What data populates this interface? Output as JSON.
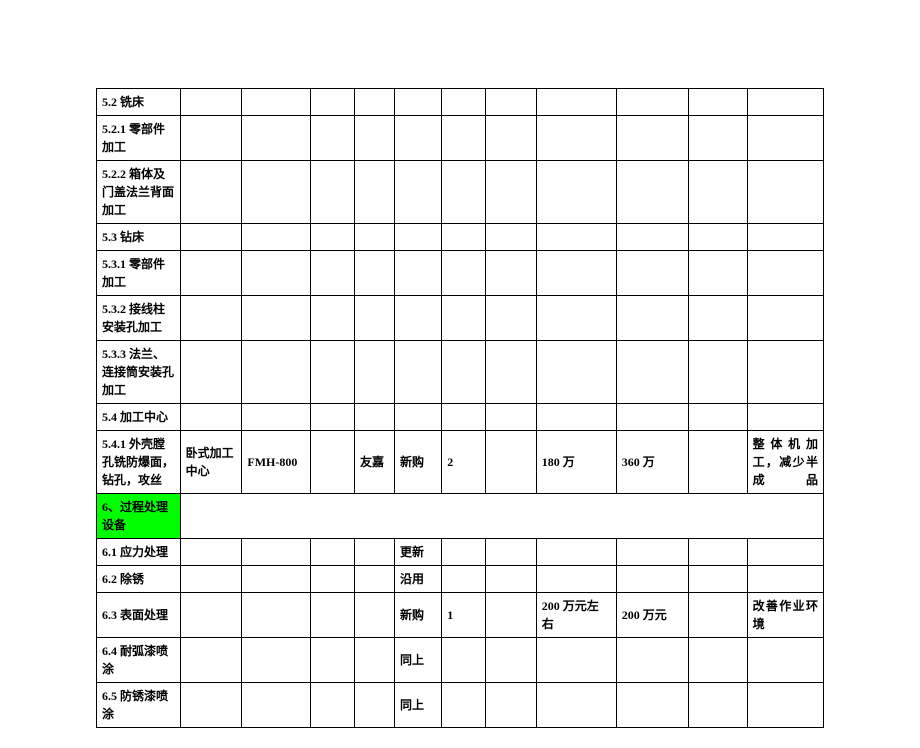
{
  "rows": [
    {
      "c0": "5.2 铣床"
    },
    {
      "c0": "5.2.1 零部件加工"
    },
    {
      "c0": "5.2.2 箱体及门盖法兰背面加工"
    },
    {
      "c0": "5.3 钻床"
    },
    {
      "c0": "5.3.1 零部件加工"
    },
    {
      "c0": "5.3.2 接线柱安装孔加工"
    },
    {
      "c0": "5.3.3 法兰、连接筒安装孔加工"
    },
    {
      "c0": "5.4 加工中心"
    },
    {
      "c0": "5.4.1 外壳膛孔铣防爆面，钻孔，攻丝",
      "c1": "卧式加工中心",
      "c2": "FMH-800",
      "c4": "友嘉",
      "c5": "新购",
      "c6": "2",
      "c8": "180 万",
      "c9": "360 万",
      "c11": "整体机加工，减少半成品"
    }
  ],
  "section_header": "6、过程处理设备",
  "rows2": [
    {
      "c0": "6.1 应力处理",
      "c5": "更新"
    },
    {
      "c0": "6.2 除锈",
      "c5": "沿用"
    },
    {
      "c0": "6.3 表面处理",
      "c5": "新购",
      "c6": "1",
      "c8": "200 万元左右",
      "c9": "200 万元",
      "c11": "改善作业环境"
    },
    {
      "c0": "6.4 耐弧漆喷涂",
      "c5": "同上"
    },
    {
      "c0": "6.5 防锈漆喷涂",
      "c5": "同上"
    }
  ]
}
